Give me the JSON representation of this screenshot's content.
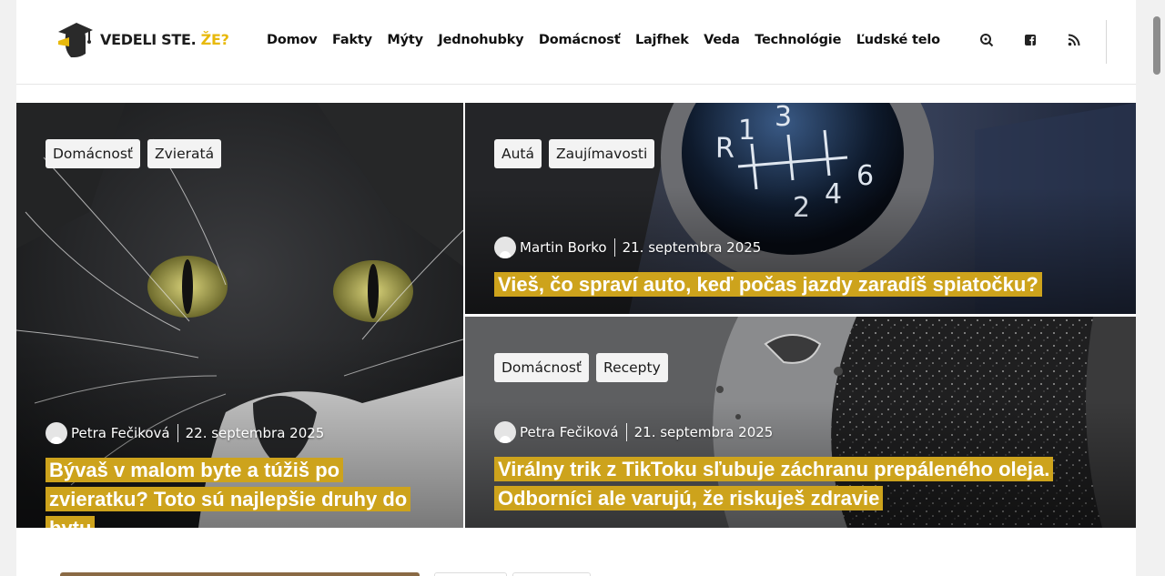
{
  "brand": {
    "name": "VEDELI STE.",
    "accent": "ŽE?",
    "accent_color": "#e8b90c"
  },
  "nav": [
    "Domov",
    "Fakty",
    "Mýty",
    "Jednohubky",
    "Domácnosť",
    "Lajfhek",
    "Veda",
    "Technológie",
    "Ľudské telo"
  ],
  "header_icons": [
    "search-icon",
    "facebook-icon",
    "rss-icon"
  ],
  "articles": [
    {
      "tags": [
        "Domácnosť",
        "Zvieratá"
      ],
      "author": "Petra Fečiková",
      "date": "22. septembra 2025",
      "title": "Bývaš v malom byte a túžiš po zvieratku? Toto sú najlepšie druhy do bytu"
    },
    {
      "tags": [
        "Autá",
        "Zaujímavosti"
      ],
      "author": "Martin Borko",
      "date": "21. septembra 2025",
      "title": "Vieš, čo spraví auto, keď počas jazdy zaradíš spiatočku?"
    },
    {
      "tags": [
        "Domácnosť",
        "Recepty"
      ],
      "author": "Petra Fečiková",
      "date": "21. septembra 2025",
      "title": "Virálny trik z TikToku sľubuje záchranu prepáleného oleja. Odborníci ale varujú, že riskuješ zdravie"
    }
  ],
  "colors": {
    "title_highlight": "#cda31c"
  }
}
